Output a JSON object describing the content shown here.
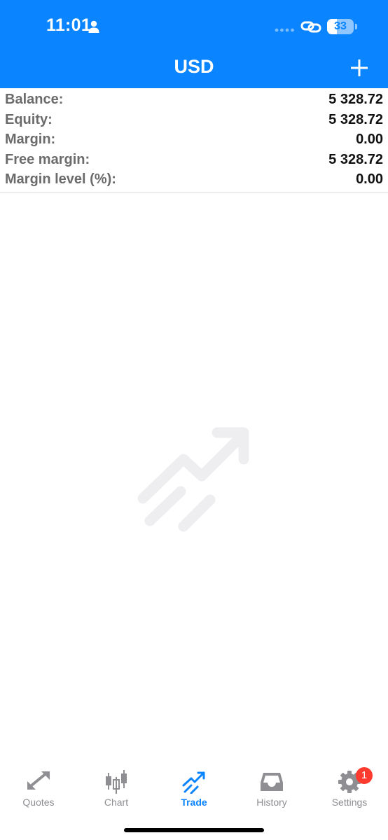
{
  "status_bar": {
    "time": "11:01",
    "battery_level": "33"
  },
  "header": {
    "title": "USD",
    "add_icon": "plus-icon"
  },
  "summary": [
    {
      "label": "Balance:",
      "value": "5 328.72"
    },
    {
      "label": "Equity:",
      "value": "5 328.72"
    },
    {
      "label": "Margin:",
      "value": "0.00"
    },
    {
      "label": "Free margin:",
      "value": "5 328.72"
    },
    {
      "label": "Margin level (%):",
      "value": "0.00"
    }
  ],
  "empty_state": {
    "icon": "trade-trend-icon"
  },
  "tabs": [
    {
      "label": "Quotes",
      "icon": "quotes-icon",
      "active": false
    },
    {
      "label": "Chart",
      "icon": "candlestick-icon",
      "active": false
    },
    {
      "label": "Trade",
      "icon": "trade-icon",
      "active": true
    },
    {
      "label": "History",
      "icon": "inbox-icon",
      "active": false
    },
    {
      "label": "Settings",
      "icon": "gear-icon",
      "active": false
    }
  ],
  "settings_badge": "1",
  "colors": {
    "accent": "#0a84ff",
    "badge": "#ff3b30",
    "inactive": "#8e8e93"
  }
}
